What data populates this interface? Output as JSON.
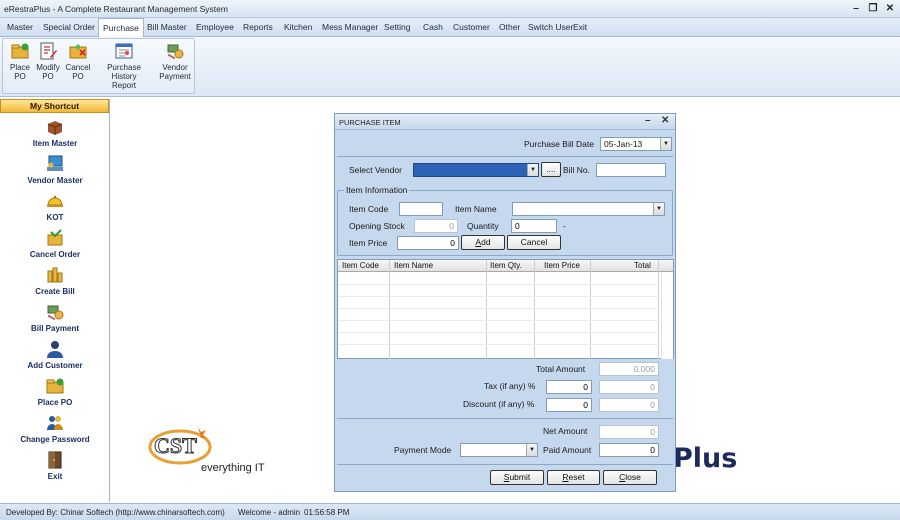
{
  "window": {
    "title": "eRestraPlus - A Complete Restaurant Management System"
  },
  "menu": [
    "Master",
    "Special Order",
    "Purchase",
    "Bill Master",
    "Employee",
    "Reports",
    "Kitchen",
    "Mess Manager",
    "Setting",
    "Cash",
    "Customer",
    "Other",
    "Switch User",
    "Exit"
  ],
  "ribbon": {
    "place_po": [
      "Place",
      "PO"
    ],
    "modify_po": [
      "Modify",
      "PO"
    ],
    "cancel_po": [
      "Cancel",
      "PO"
    ],
    "history": [
      "Purchase History",
      "Report"
    ],
    "vendor_payment": [
      "Vendor",
      "Payment"
    ]
  },
  "shortcut": {
    "header": "My Shortcut",
    "items": [
      "Item Master",
      "Vendor Master",
      "KOT",
      "Cancel Order",
      "Create Bill",
      "Bill Payment",
      "Add Customer",
      "Place PO",
      "Change Password",
      "Exit"
    ]
  },
  "branding": {
    "logo": "CST",
    "tagline": "everything IT",
    "product_fragment": "Plus"
  },
  "dialog": {
    "title": "PURCHASE ITEM",
    "bill_date_label": "Purchase Bill Date",
    "bill_date": "05-Jan-13",
    "vendor_label": "Select Vendor",
    "browse": "....",
    "bill_no_label": "Bill No.",
    "bill_no": "",
    "item_info_legend": "Item Information",
    "item_code_label": "Item Code",
    "item_name_label": "Item Name",
    "opening_stock_label": "Opening Stock",
    "opening_stock": "0",
    "quantity_label": "Quantity",
    "quantity": "0",
    "dash": "-",
    "item_price_label": "Item Price",
    "item_price": "0",
    "add": "Add",
    "cancel": "Cancel",
    "grid_headers": [
      "Item Code",
      "Item Name",
      "Item Qty.",
      "Item Price",
      "Total"
    ],
    "total_amount_label": "Total Amount",
    "total_amount": "0.000",
    "tax_label": "Tax (if any) %",
    "tax_pct": "0",
    "tax_amt": "0",
    "discount_label": "Discount (if any) %",
    "discount_pct": "0",
    "discount_amt": "0",
    "net_amount_label": "Net Amount",
    "net_amount": "0",
    "payment_mode_label": "Payment Mode",
    "paid_amount_label": "Paid Amount",
    "paid_amount": "0",
    "submit": "Submit",
    "reset": "Reset",
    "close": "Close"
  },
  "status": {
    "developer": "Developed By: Chinar Softech (http://www.chinarsoftech.com)",
    "welcome": "Welcome - admin",
    "time": "01:56:58 PM"
  }
}
